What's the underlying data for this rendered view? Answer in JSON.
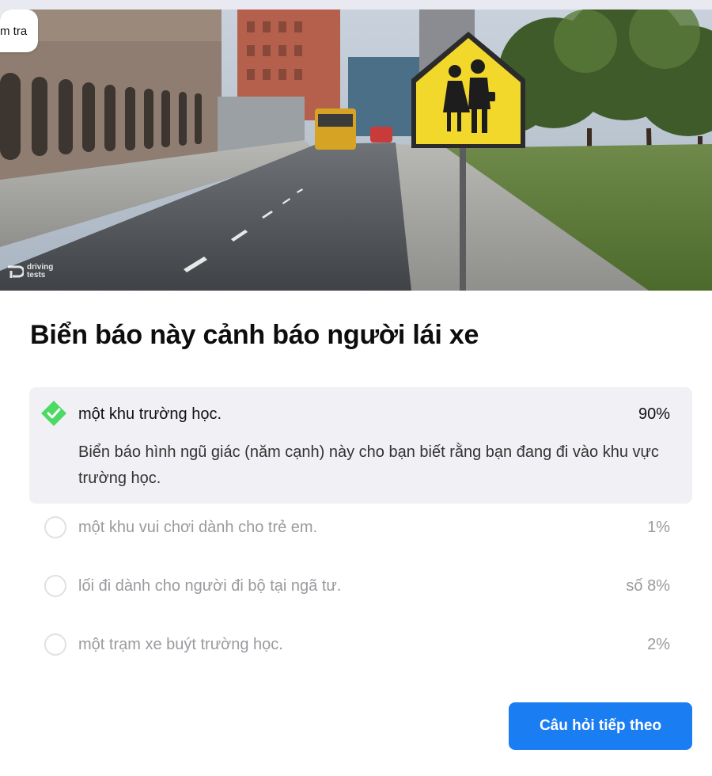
{
  "header": {
    "check_label": "m tra"
  },
  "image": {
    "watermark_line1": "driving",
    "watermark_line2": "tests"
  },
  "question": {
    "text": "Biển báo này cảnh báo người lái xe"
  },
  "answers": [
    {
      "label": "một khu trường học.",
      "percent": "90%",
      "correct": true,
      "explanation": "Biển báo hình ngũ giác (năm cạnh) này cho bạn biết rằng bạn đang đi vào khu vực trường học."
    },
    {
      "label": "một khu vui chơi dành cho trẻ em.",
      "percent": "1%",
      "correct": false
    },
    {
      "label": "lối đi dành cho người đi bộ tại ngã tư.",
      "percent": "số 8%",
      "correct": false
    },
    {
      "label": "một trạm xe buýt trường học.",
      "percent": "2%",
      "correct": false
    }
  ],
  "actions": {
    "next_label": "Câu hỏi tiếp theo"
  },
  "colors": {
    "accent": "#1a7df2",
    "correct": "#4cd964",
    "sign_yellow": "#f2d82b"
  }
}
